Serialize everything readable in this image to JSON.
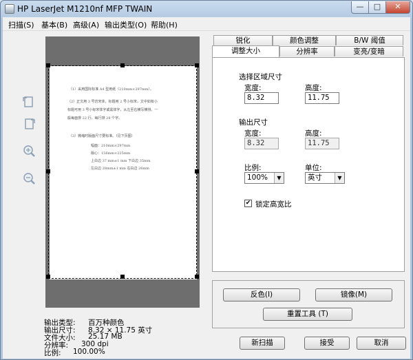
{
  "window": {
    "title": "HP LaserJet M1210nf MFP TWAIN",
    "controls": {
      "minimize": "—",
      "maximize": "□",
      "close": "✕"
    }
  },
  "menu": [
    {
      "label": "扫描(S)"
    },
    {
      "label": "基本(B)"
    },
    {
      "label": "高级(A)"
    },
    {
      "label": "输出类型(O)"
    },
    {
      "label": "帮助(H)"
    }
  ],
  "preview": {
    "page_lines": [
      "（1）采用国际标准 A4 型用纸（210mm×297mm）。",
      "（2）正文用 3 号仿宋体，标题用 2 号小标宋，文中如有小",
      "标题可用 3 号小标宋体字或黑体字，从左至右横写横排。一",
      "般每面排 22 行，每行排 28 个字。",
      "（3）微缩时版面尺寸要标准。（见下页图）",
      "幅面：210mm×297mm",
      "版心：156mm×225mm",
      "上白边 37 mm±1 mm      下白边 35mm",
      "左白边 28mm±1 mm       右白边 26mm"
    ]
  },
  "tools": [
    {
      "icon": "rotate-left-icon"
    },
    {
      "icon": "rotate-right-icon"
    },
    {
      "icon": "zoom-in-icon"
    },
    {
      "icon": "zoom-out-icon"
    }
  ],
  "info": {
    "output_type_label": "输出类型:",
    "output_type_value": "百万种颜色",
    "output_size_label": "输出尺寸:",
    "output_size_value": "8.32 × 11.75 英寸",
    "file_size_label": "文件大小:",
    "file_size_value": "25.17 MB",
    "resolution_label": "分辨率:",
    "resolution_value": "300 dpi",
    "scale_label": "比例:",
    "scale_value": "100.00%"
  },
  "tabs": {
    "row_back": [
      {
        "label": "锐化"
      },
      {
        "label": "颜色调整"
      },
      {
        "label": "B/W 阈值"
      }
    ],
    "row_front": [
      {
        "label": "调整大小"
      },
      {
        "label": "分辨率"
      },
      {
        "label": "变亮/变暗"
      }
    ]
  },
  "resize": {
    "select_area_title": "选择区域尺寸",
    "width_label": "宽度:",
    "height_label": "高度:",
    "select_width": "8.32",
    "select_height": "11.75",
    "output_title": "输出尺寸",
    "out_width_label": "宽度:",
    "out_height_label": "高度:",
    "out_width": "8.32",
    "out_height": "11.75",
    "scale_label": "比例:",
    "scale_value": "100%",
    "unit_label": "单位:",
    "unit_value": "英寸",
    "lock_ratio_label": "锁定高宽比",
    "lock_ratio_checked": true
  },
  "buttons": {
    "invert": "反色(I)",
    "mirror": "镜像(M)",
    "reset_tools": "重置工具 (T)",
    "new_scan": "新扫描",
    "accept": "接受",
    "cancel": "取消"
  }
}
